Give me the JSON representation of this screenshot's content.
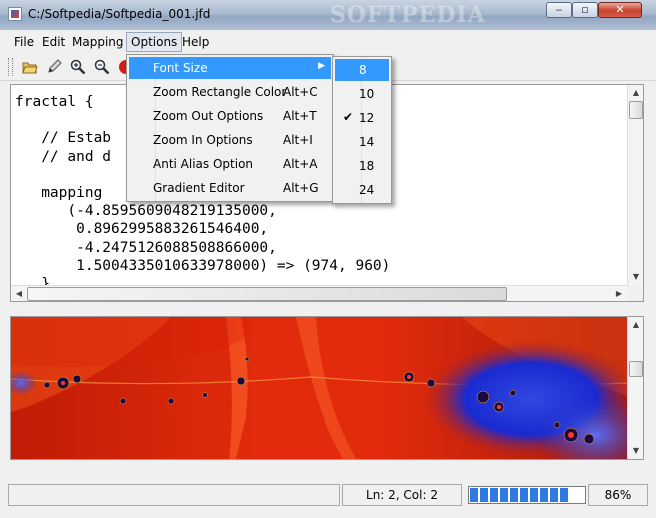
{
  "window": {
    "title": "C:/Softpedia/Softpedia_001.jfd",
    "watermark": "SOFTPEDIA",
    "minimize": "‒",
    "maximize": "▫",
    "close": "✕"
  },
  "menubar": {
    "items": [
      "File",
      "Edit",
      "Mapping",
      "Options",
      "Help"
    ]
  },
  "editor": {
    "code_lines": [
      "fractal {",
      "",
      "   // Estab              mplex coordinates",
      "   // and d",
      "",
      "   mapping",
      "      (-4.8595609048219135000,",
      "       0.8962995883261546400,",
      "       -4.2475126088508866000,",
      "       1.5004335010633978000) => (974, 960)",
      "   }"
    ]
  },
  "options_menu": {
    "items": [
      {
        "label": "Font Size",
        "shortcut": "",
        "submenu": true
      },
      {
        "label": "Zoom Rectangle Color",
        "shortcut": "Alt+C"
      },
      {
        "label": "Zoom Out Options",
        "shortcut": "Alt+T"
      },
      {
        "label": "Zoom In Options",
        "shortcut": "Alt+I"
      },
      {
        "label": "Anti Alias Option",
        "shortcut": "Alt+A"
      },
      {
        "label": "Gradient Editor",
        "shortcut": "Alt+G"
      }
    ]
  },
  "font_size_menu": {
    "items": [
      "8",
      "10",
      "12",
      "14",
      "18",
      "24"
    ],
    "checked": "12",
    "check_mark": "✔"
  },
  "statusbar": {
    "position": "Ln: 2, Col: 2",
    "progress_percent": 86,
    "progress_label": "86%"
  },
  "colors": {
    "menu_highlight": "#3399ff",
    "fractal_base": "#d8260a"
  },
  "toolbar_icons": [
    "open-folder-icon",
    "pen-icon",
    "zoom-in-icon",
    "zoom-out-icon",
    "stop-icon"
  ]
}
